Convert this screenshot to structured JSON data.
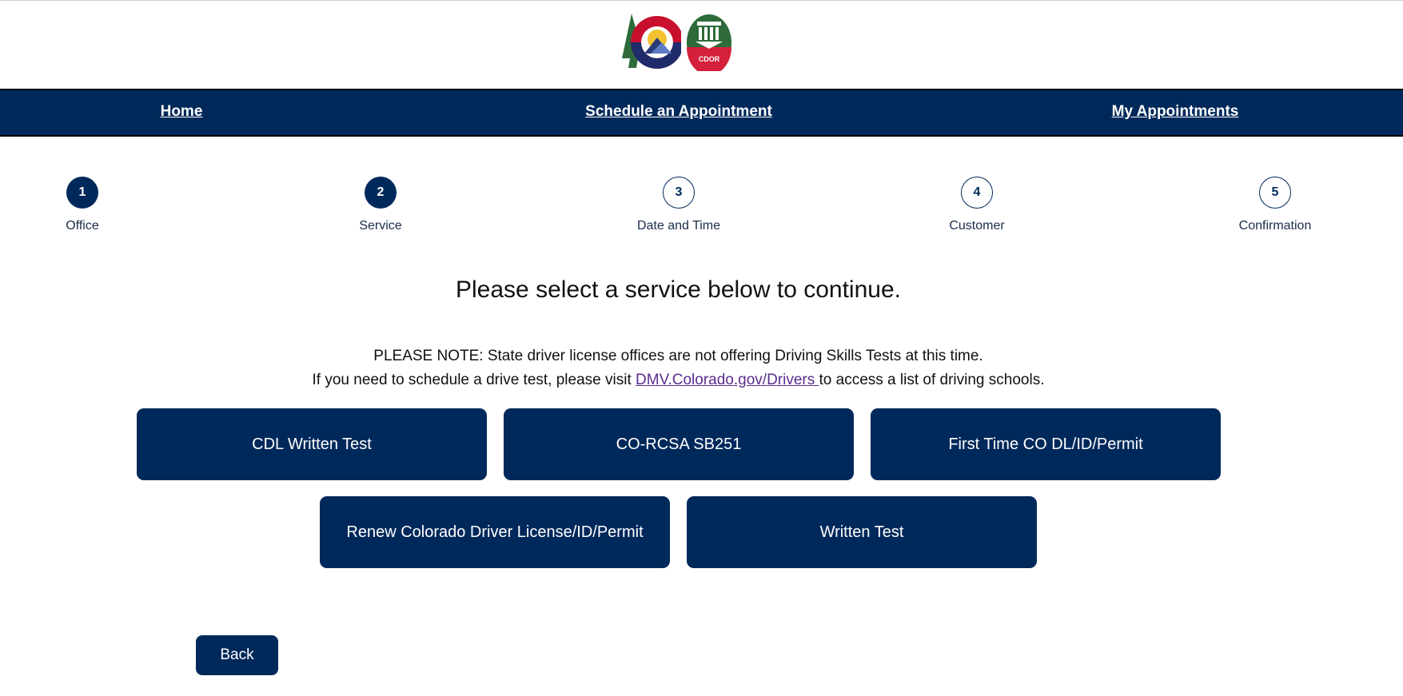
{
  "header": {
    "state_logo_icon": "colorado-c-logo-icon",
    "cdor_logo_icon": "cdor-seal-icon",
    "cdor_logo_text": "CDOR"
  },
  "nav": {
    "home": "Home",
    "schedule": "Schedule an Appointment",
    "my_appointments": "My Appointments"
  },
  "steps": [
    {
      "number": "1",
      "label": "Office",
      "state": "done"
    },
    {
      "number": "2",
      "label": "Service",
      "state": "done"
    },
    {
      "number": "3",
      "label": "Date and Time",
      "state": "todo"
    },
    {
      "number": "4",
      "label": "Customer",
      "state": "todo"
    },
    {
      "number": "5",
      "label": "Confirmation",
      "state": "todo"
    }
  ],
  "main": {
    "heading": "Please select a service below to continue.",
    "note_line1": "PLEASE NOTE: State driver license offices are not offering Driving Skills Tests at this time.",
    "note_line2_pre": "If you need to schedule a drive test, please visit ",
    "note_link": "DMV.Colorado.gov/Drivers ",
    "note_line2_post": "to access a list of driving schools."
  },
  "services": [
    "CDL Written Test",
    "CO-RCSA SB251",
    "First Time CO DL/ID/Permit",
    "Renew Colorado Driver License/ID/Permit",
    "Written Test"
  ],
  "footer": {
    "back_label": "Back"
  },
  "colors": {
    "primary": "#00295b",
    "link": "#5b2d8e"
  }
}
